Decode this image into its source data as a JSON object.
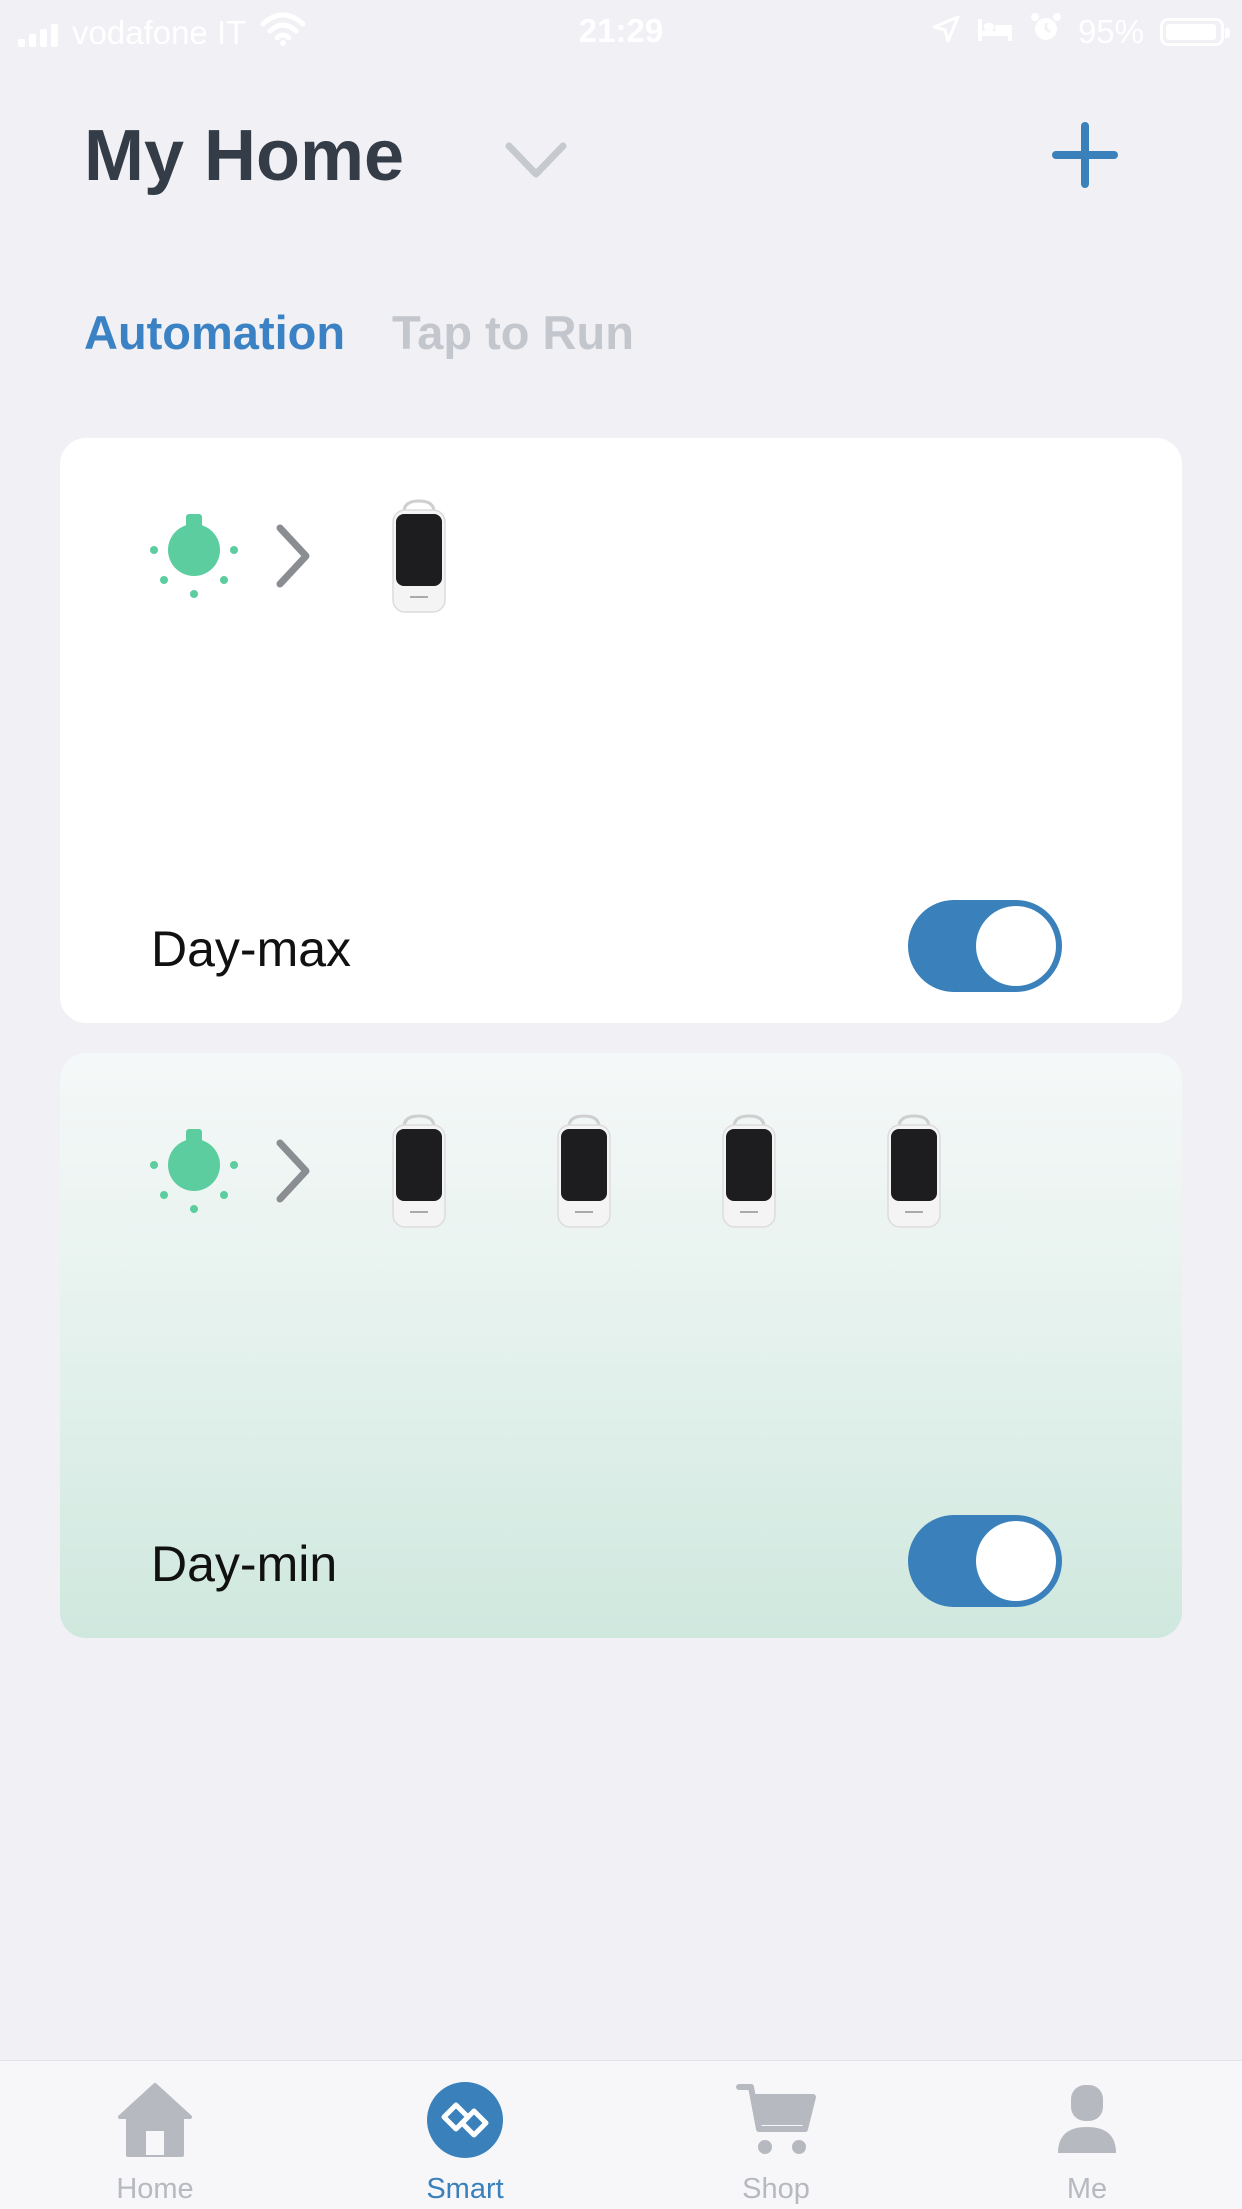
{
  "status_bar": {
    "carrier": "vodafone IT",
    "time": "21:29",
    "battery": "95%",
    "battery_level": 0.95
  },
  "header": {
    "title": "My Home",
    "chevron_icon": "chevron-down-icon",
    "add_icon": "plus-icon"
  },
  "tabs": [
    {
      "label": "Automation",
      "active": true
    },
    {
      "label": "Tap to Run",
      "active": false
    }
  ],
  "cards": [
    {
      "name": "Day-max",
      "condition_icon": "sun-icon",
      "device_count": 1,
      "enabled": true
    },
    {
      "name": "Day-min",
      "condition_icon": "sun-icon",
      "device_count": 4,
      "enabled": true
    }
  ],
  "tabbar": {
    "items": [
      {
        "label": "Home",
        "icon": "home-icon",
        "active": false
      },
      {
        "label": "Smart",
        "icon": "smart-icon",
        "active": true
      },
      {
        "label": "Shop",
        "icon": "cart-icon",
        "active": false
      },
      {
        "label": "Me",
        "icon": "person-icon",
        "active": false
      }
    ]
  },
  "colors": {
    "accent": "#3a80bb",
    "sun_green": "#5ccd9f",
    "background": "#f0f0f5"
  }
}
